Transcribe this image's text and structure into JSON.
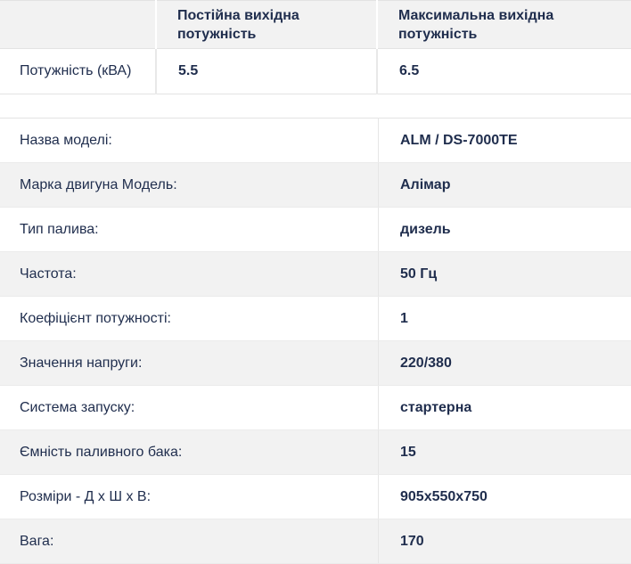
{
  "power_table": {
    "columns": [
      "Постійна вихідна потужність",
      "Максимальна вихідна потужність"
    ],
    "row_label": "Потужність (кВА)",
    "values": [
      "5.5",
      "6.5"
    ]
  },
  "specs": [
    {
      "label": "Назва моделі:",
      "value": "ALM / DS-7000TE"
    },
    {
      "label": "Марка двигуна Модель:",
      "value": "Алімар"
    },
    {
      "label": "Тип палива:",
      "value": "дизель"
    },
    {
      "label": "Частота:",
      "value": "50 Гц"
    },
    {
      "label": "Коефіцієнт потужності:",
      "value": "1"
    },
    {
      "label": "Значення напруги:",
      "value": "220/380"
    },
    {
      "label": "Система запуску:",
      "value": "стартерна"
    },
    {
      "label": "Ємність паливного бака:",
      "value": "15"
    },
    {
      "label": "Розміри - Д х Ш х В:",
      "value": "905x550x750"
    },
    {
      "label": "Вага:",
      "value": "170"
    }
  ]
}
